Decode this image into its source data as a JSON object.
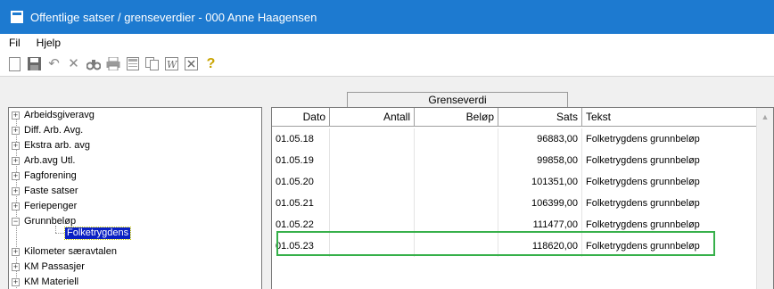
{
  "window": {
    "title": "Offentlige satser / grenseverdier - 000 Anne Haagensen"
  },
  "menu": [
    "Fil",
    "Hjelp"
  ],
  "toolbar": [
    "new-doc-icon",
    "save-icon",
    "undo-icon",
    "delete-icon",
    "find-icon",
    "print-icon",
    "calculator-icon",
    "copy-icon",
    "word-icon",
    "excel-icon",
    "help-icon"
  ],
  "tab": {
    "label": "Grenseverdi"
  },
  "tree": {
    "items": [
      {
        "label": "Arbeidsgiveravg",
        "sign": "+"
      },
      {
        "label": "Diff. Arb. Avg.",
        "sign": "+"
      },
      {
        "label": "Ekstra arb. avg",
        "sign": "+"
      },
      {
        "label": "Arb.avg Utl.",
        "sign": "+"
      },
      {
        "label": "Fagforening",
        "sign": "+"
      },
      {
        "label": "Faste satser",
        "sign": "+"
      },
      {
        "label": "Feriepenger",
        "sign": "+"
      },
      {
        "label": "Grunnbeløp",
        "sign": "−"
      },
      {
        "label": "Folketrygdens",
        "child": true
      },
      {
        "label": "Kilometer særavtalen",
        "sign": "+"
      },
      {
        "label": "KM Passasjer",
        "sign": "+"
      },
      {
        "label": "KM Materiell",
        "sign": "+"
      }
    ]
  },
  "grid": {
    "columns": [
      "Dato",
      "Antall",
      "Beløp",
      "Sats",
      "Tekst"
    ],
    "rows": [
      {
        "dato": "01.05.18",
        "antall": "",
        "belop": "",
        "sats": "96883,00",
        "tekst": "Folketrygdens grunnbeløp"
      },
      {
        "dato": "01.05.19",
        "antall": "",
        "belop": "",
        "sats": "99858,00",
        "tekst": "Folketrygdens grunnbeløp"
      },
      {
        "dato": "01.05.20",
        "antall": "",
        "belop": "",
        "sats": "101351,00",
        "tekst": "Folketrygdens grunnbeløp"
      },
      {
        "dato": "01.05.21",
        "antall": "",
        "belop": "",
        "sats": "106399,00",
        "tekst": "Folketrygdens grunnbeløp"
      },
      {
        "dato": "01.05.22",
        "antall": "",
        "belop": "",
        "sats": "111477,00",
        "tekst": "Folketrygdens grunnbeløp"
      },
      {
        "dato": "01.05.23",
        "antall": "",
        "belop": "",
        "sats": "118620,00",
        "tekst": "Folketrygdens grunnbeløp"
      }
    ]
  },
  "colors": {
    "titlebar": "#1d7ad0",
    "selection": "#0a20c4",
    "highlight": "#36b04a"
  }
}
